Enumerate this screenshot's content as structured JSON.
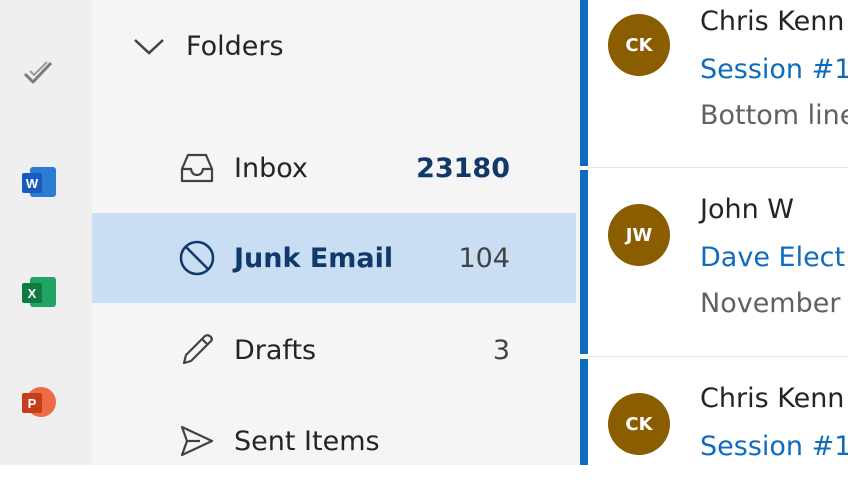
{
  "colors": {
    "accent": "#0f6cbd",
    "selected_bg": "#c9def3",
    "avatar_bg": "#8a5e00",
    "word": "#185abd",
    "excel": "#107c41",
    "powerpoint": "#c43e1c"
  },
  "app_rail": {
    "icons": [
      "todo-check-icon",
      "word-icon",
      "excel-icon",
      "powerpoint-icon"
    ],
    "word_letter": "W",
    "excel_letter": "X",
    "powerpoint_letter": "P"
  },
  "folders": {
    "title": "Folders",
    "items": [
      {
        "label": "Inbox",
        "count": "23180",
        "icon": "inbox-icon"
      },
      {
        "label": "Junk Email",
        "count": "104",
        "icon": "blocked-icon",
        "selected": true
      },
      {
        "label": "Drafts",
        "count": "3",
        "icon": "pencil-icon"
      },
      {
        "label": "Sent Items",
        "count": "",
        "icon": "send-icon"
      }
    ]
  },
  "messages": [
    {
      "initials": "CK",
      "sender": "Chris Kenn",
      "subject": "Session #1",
      "preview": "Bottom line"
    },
    {
      "initials": "JW",
      "sender": "John W",
      "subject": "Dave Elect",
      "preview": "November"
    },
    {
      "initials": "CK",
      "sender": "Chris Kenn",
      "subject": "Session #1",
      "preview": ""
    }
  ]
}
